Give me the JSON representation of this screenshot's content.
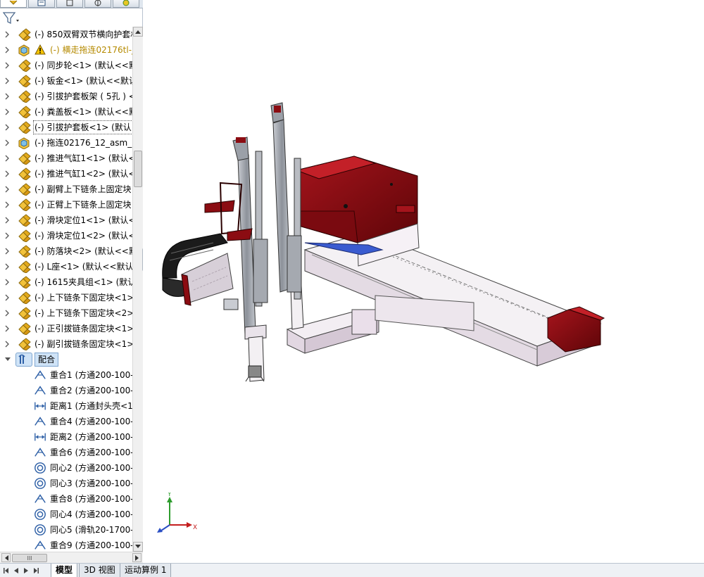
{
  "panel_tabs": [
    {
      "icon": "feature-manager-icon",
      "active": true
    },
    {
      "icon": "property-manager-icon",
      "active": false
    },
    {
      "icon": "configuration-manager-icon",
      "active": false
    },
    {
      "icon": "dimxpert-manager-icon",
      "active": false
    },
    {
      "icon": "display-manager-icon",
      "active": false
    }
  ],
  "filter": {
    "icon": "filter-icon"
  },
  "tree": {
    "components": [
      {
        "label": "(-) 850双臂双节横向护套材",
        "icon": "assembly-icon",
        "warning": false
      },
      {
        "label": "(-) 横走拖连02176tl-j",
        "icon": "part-icon",
        "warning": true
      },
      {
        "label": "(-) 同步轮<1> (默认<<默",
        "icon": "assembly-icon",
        "warning": false
      },
      {
        "label": "(-) 钣金<1> (默认<<默认",
        "icon": "assembly-icon",
        "warning": false
      },
      {
        "label": "(-) 引拔护套板架 ( 5孔 ) <",
        "icon": "assembly-icon",
        "warning": false
      },
      {
        "label": "(-) 粪盖板<1> (默认<<默",
        "icon": "assembly-icon",
        "warning": false
      },
      {
        "label": "(-) 引拔护套板<1> (默认<",
        "icon": "assembly-icon",
        "warning": false,
        "selected": true
      },
      {
        "label": "(-) 拖连02176_12_asm_1",
        "icon": "part-icon",
        "warning": false
      },
      {
        "label": "(-) 推进气缸1<1> (默认<",
        "icon": "assembly-icon",
        "warning": false
      },
      {
        "label": "(-) 推进气缸1<2> (默认<",
        "icon": "assembly-icon",
        "warning": false
      },
      {
        "label": "(-) 副臂上下链条上固定块",
        "icon": "assembly-icon",
        "warning": false
      },
      {
        "label": "(-) 正臂上下链条上固定块",
        "icon": "assembly-icon",
        "warning": false
      },
      {
        "label": "(-) 滑块定位1<1> (默认<",
        "icon": "assembly-icon",
        "warning": false
      },
      {
        "label": "(-) 滑块定位1<2> (默认<",
        "icon": "assembly-icon",
        "warning": false
      },
      {
        "label": "(-) 防落块<2> (默认<<默",
        "icon": "assembly-icon",
        "warning": false
      },
      {
        "label": "(-) L座<1> (默认<<默认>",
        "icon": "assembly-icon",
        "warning": false
      },
      {
        "label": "(-) 1615夹具组<1> (默认",
        "icon": "assembly-icon",
        "warning": false
      },
      {
        "label": "(-) 上下链条下固定块<1>",
        "icon": "assembly-icon",
        "warning": false
      },
      {
        "label": "(-) 上下链条下固定块<2>",
        "icon": "assembly-icon",
        "warning": false
      },
      {
        "label": "(-) 正引拔链条固定块<1>",
        "icon": "assembly-icon",
        "warning": false
      },
      {
        "label": "(-) 副引拔链条固定块<1>",
        "icon": "assembly-icon",
        "warning": false
      }
    ],
    "mates_folder": {
      "label": "配合",
      "icon": "mates-folder-icon"
    },
    "mates": [
      {
        "label": "重合1 (方通200-100-",
        "icon": "coincident-icon"
      },
      {
        "label": "重合2 (方通200-100-",
        "icon": "coincident-icon"
      },
      {
        "label": "距离1 (方通封头壳<1",
        "icon": "distance-icon"
      },
      {
        "label": "重合4 (方通200-100-",
        "icon": "coincident-icon"
      },
      {
        "label": "距离2 (方通200-100-",
        "icon": "distance-icon"
      },
      {
        "label": "重合6 (方通200-100-",
        "icon": "coincident-icon"
      },
      {
        "label": "同心2 (方通200-100-",
        "icon": "concentric-icon"
      },
      {
        "label": "同心3 (方通200-100-",
        "icon": "concentric-icon"
      },
      {
        "label": "重合8 (方通200-100-",
        "icon": "coincident-icon"
      },
      {
        "label": "同心4 (方通200-100-",
        "icon": "concentric-icon"
      },
      {
        "label": "同心5 (滑轨20-1700-",
        "icon": "concentric-icon"
      },
      {
        "label": "重合9 (方通200-100-",
        "icon": "coincident-icon"
      }
    ]
  },
  "hscroll": {
    "thumb_label": "III"
  },
  "triad": {
    "x_label": "X",
    "y_label": "Y"
  },
  "bottom_tabs": [
    {
      "label": "模型",
      "active": true
    },
    {
      "label": "3D 视图",
      "active": false
    },
    {
      "label": "运动算例 1",
      "active": false
    }
  ],
  "colors": {
    "housing_red": "#8b0c12",
    "frame_white": "#f4f1f4",
    "rail_grey": "#9aa0a8",
    "accent_blue": "#3a5bd0",
    "selection_blue": "#cfe3f7"
  }
}
